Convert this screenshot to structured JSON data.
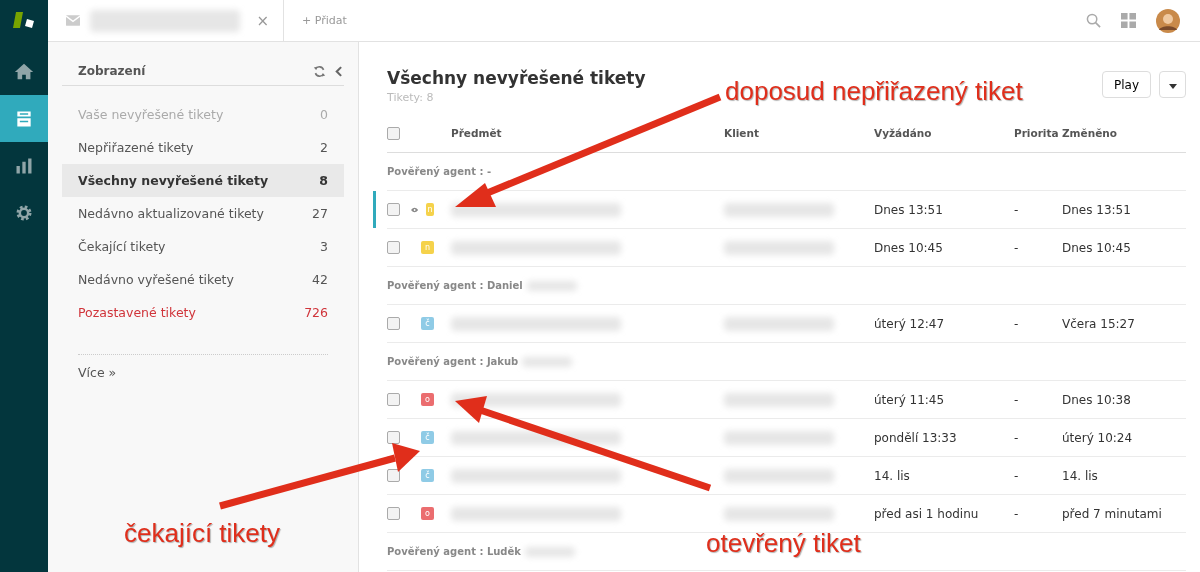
{
  "top_bar": {
    "tab": {
      "close": "×"
    },
    "add": "+ Přidat"
  },
  "sidebar": {
    "title": "Zobrazení",
    "items": [
      {
        "label": "Vaše nevyřešené tikety",
        "count": "0",
        "selected": false,
        "kind": "muted"
      },
      {
        "label": "Nepřiřazené tikety",
        "count": "2",
        "selected": false,
        "kind": "normal"
      },
      {
        "label": "Všechny nevyřešené tikety",
        "count": "8",
        "selected": true,
        "kind": "normal"
      },
      {
        "label": "Nedávno aktualizované tikety",
        "count": "27",
        "selected": false,
        "kind": "normal"
      },
      {
        "label": "Čekající tikety",
        "count": "3",
        "selected": false,
        "kind": "normal"
      },
      {
        "label": "Nedávno vyřešené tikety",
        "count": "42",
        "selected": false,
        "kind": "normal"
      },
      {
        "label": "Pozastavené tikety",
        "count": "726",
        "selected": false,
        "kind": "alert"
      }
    ],
    "more": "Více »"
  },
  "view": {
    "title": "Všechny nevyřešené tikety",
    "count": "Tikety: 8",
    "play": "Play"
  },
  "table": {
    "select_all": {
      "checked": false
    },
    "columns": [
      "Předmět",
      "Klient",
      "Vyžádáno",
      "Priorita",
      "Změněno"
    ],
    "groups": [
      {
        "label": "Pověřený agent : -",
        "rows": [
          {
            "status": "n",
            "color": "#f5d24b",
            "requested": "Dnes 13:51",
            "priority": "-",
            "changed": "Dnes 13:51",
            "selected": true
          },
          {
            "status": "n",
            "color": "#f5d24b",
            "requested": "Dnes 10:45",
            "priority": "-",
            "changed": "Dnes 10:45",
            "selected": false
          }
        ]
      },
      {
        "label": "Pověřený agent : Daniel",
        "rows": [
          {
            "status": "č",
            "color": "#8fcbe6",
            "requested": "úterý 12:47",
            "priority": "-",
            "changed": "Včera 15:27",
            "selected": false
          }
        ]
      },
      {
        "label": "Pověřený agent : Jakub",
        "rows": [
          {
            "status": "o",
            "color": "#eb6d6f",
            "requested": "úterý 11:45",
            "priority": "-",
            "changed": "Dnes 10:38",
            "selected": false
          },
          {
            "status": "č",
            "color": "#8fcbe6",
            "requested": "pondělí 13:33",
            "priority": "-",
            "changed": "úterý 10:24",
            "selected": false
          },
          {
            "status": "č",
            "color": "#8fcbe6",
            "requested": "14. lis",
            "priority": "-",
            "changed": "14. lis",
            "selected": false
          },
          {
            "status": "o",
            "color": "#eb6d6f",
            "requested": "před asi 1 hodinu",
            "priority": "-",
            "changed": "před 7 minutami",
            "selected": false
          }
        ]
      },
      {
        "label": "Pověřený agent : Luděk"
      }
    ]
  },
  "annotations": [
    {
      "text": "doposud nepřiřazený tiket"
    },
    {
      "text": "čekající tikety"
    },
    {
      "text": "otevřený tiket"
    }
  ]
}
